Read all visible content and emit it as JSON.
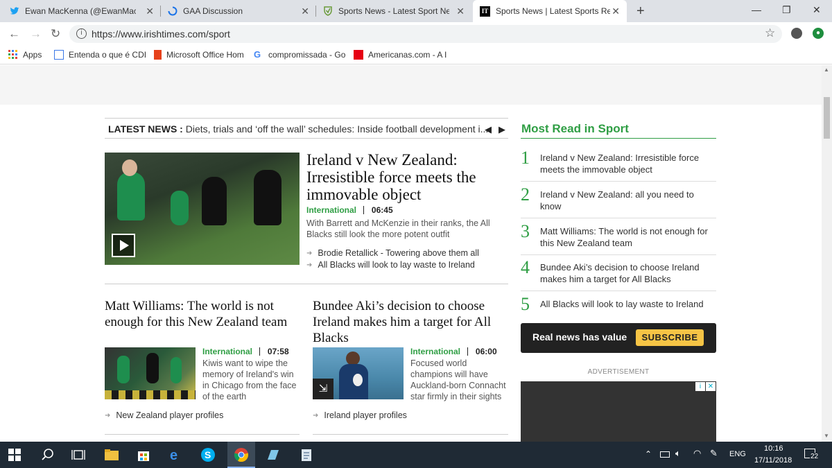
{
  "browser": {
    "tabs": [
      {
        "title": "Ewan MacKenna (@EwanMacKenna)",
        "icon": "twitter-icon",
        "color": "#1da1f2"
      },
      {
        "title": "GAA Discussion",
        "icon": "loading-icon",
        "color": "#1a73e8"
      },
      {
        "title": "Sports News - Latest Sport News",
        "icon": "shield-icon",
        "color": "#6a9a3a"
      },
      {
        "title": "Sports News | Latest Sports Results",
        "icon": "irish-times-icon",
        "color": "#000000"
      }
    ],
    "url": "https://www.irishtimes.com/sport",
    "bookmarks": [
      {
        "label": "Apps"
      },
      {
        "label": "Entenda o que é CDI"
      },
      {
        "label": "Microsoft Office Hom"
      },
      {
        "label": "compromissada - Go"
      },
      {
        "label": "Americanas.com - A I"
      }
    ]
  },
  "latest_news": {
    "label": "LATEST NEWS :",
    "headline": "Diets, trials and ‘off the wall’ schedules: Inside football development i..."
  },
  "lead": {
    "headline": "Ireland v New Zealand: Irresistible force meets the immovable object",
    "category": "International",
    "time": "06:45",
    "summary": "With Barrett and McKenzie in their ranks, the All Blacks still look the more potent outfit",
    "related": [
      "Brodie Retallick - Towering above them all",
      "All Blacks will look to lay waste to Ireland"
    ]
  },
  "story2": {
    "headline": "Matt Williams: The world is not enough for this New Zealand team",
    "category": "International",
    "time": "07:58",
    "summary": "Kiwis want to wipe the memory of Ireland's win in Chicago from the face of the earth",
    "related": "New Zealand player profiles"
  },
  "story3": {
    "headline": "Bundee Aki’s decision to choose Ireland makes him a target for All Blacks",
    "category": "International",
    "time": "06:00",
    "summary": "Focused world champions will have Auckland-born Connacht star firmly in their sights",
    "related": "Ireland player profiles"
  },
  "most_read": {
    "title": "Most Read in Sport",
    "items": [
      {
        "num": "1",
        "text": "Ireland v New Zealand: Irresistible force meets the immovable object"
      },
      {
        "num": "2",
        "text": "Ireland v New Zealand: all you need to know"
      },
      {
        "num": "3",
        "text": "Matt Williams: The world is not enough for this New Zealand team"
      },
      {
        "num": "4",
        "text": "Bundee Aki’s decision to choose Ireland makes him a target for All Blacks"
      },
      {
        "num": "5",
        "text": "All Blacks will look to lay waste to Ireland"
      }
    ]
  },
  "promo": {
    "text": "Real news has value",
    "button": "SUBSCRIBE"
  },
  "advertisement_label": "ADVERTISEMENT",
  "taskbar": {
    "language": "ENG",
    "time": "10:16",
    "date": "17/11/2018",
    "notifications": "22"
  },
  "colors": {
    "accent_green": "#2f9e44",
    "subscribe_yellow": "#f6c445",
    "promo_bg": "#222222"
  }
}
